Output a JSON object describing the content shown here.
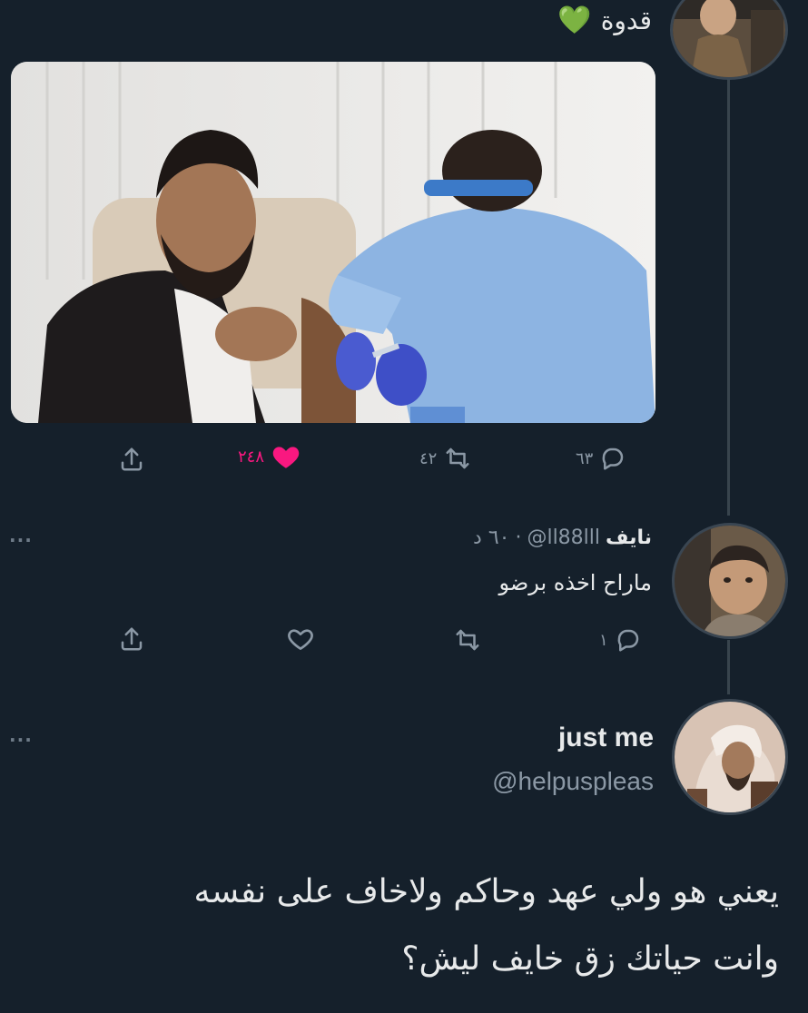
{
  "top_tweet": {
    "text": "قدوة",
    "emoji": "💚",
    "media_alt_icon": "photo-vaccination",
    "actions": {
      "replies": "٦٣",
      "retweets": "٤٢",
      "likes": "٢٤٨",
      "like_color": "#f91880"
    }
  },
  "reply": {
    "name": "نايف",
    "handle": "@ll88lll",
    "separator": "·",
    "time": "٦٠ د",
    "text": "ماراح اخذه برضو",
    "replies": "١",
    "more": "···"
  },
  "quote": {
    "name": "just me",
    "handle": "@helpuspleas",
    "more": "···",
    "line1": "يعني هو ولي عهد وحاكم ولاخاف على نفسه",
    "line2": "وانت حياتك زق خايف ليش؟"
  },
  "colors": {
    "background": "#15202b",
    "muted": "#8b98a5",
    "like": "#f91880",
    "thread_line": "#38444d"
  }
}
